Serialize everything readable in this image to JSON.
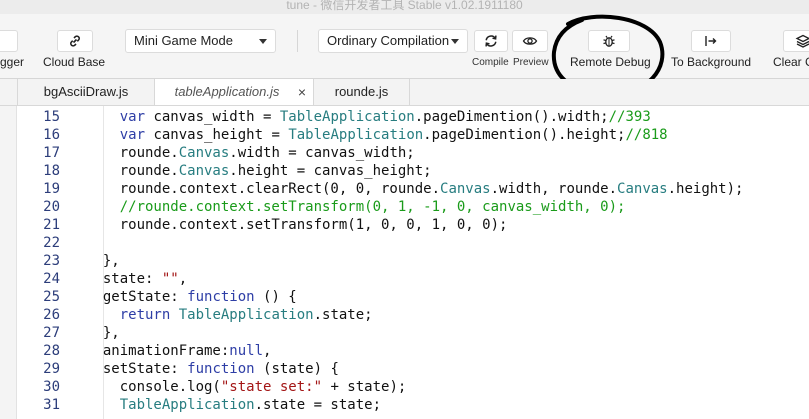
{
  "window": {
    "title": "tune - 微信开发者工具 Stable v1.02.1911180"
  },
  "toolbar": {
    "debugger_label": "gger",
    "cloud_label": "Cloud Base",
    "mode_select": "Mini Game Mode",
    "compile_select": "Ordinary Compilation",
    "compile_label": "Compile",
    "preview_label": "Preview",
    "remote_debug_label": "Remote Debug",
    "background_label": "To Background",
    "clear_label": "Clear C"
  },
  "tabs": [
    {
      "label": "bgAsciiDraw.js"
    },
    {
      "label": "tableApplication.js",
      "close": "×"
    },
    {
      "label": "rounde.js"
    }
  ],
  "editor": {
    "lines": [
      {
        "n": "15",
        "text": "    var canvas_width = TableApplication.pageDimention().width;//393"
      },
      {
        "n": "16",
        "text": "    var canvas_height = TableApplication.pageDimention().height;//818"
      },
      {
        "n": "17",
        "text": "    rounde.Canvas.width = canvas_width;"
      },
      {
        "n": "18",
        "text": "    rounde.Canvas.height = canvas_height;"
      },
      {
        "n": "19",
        "text": "    rounde.context.clearRect(0, 0, rounde.Canvas.width, rounde.Canvas.height);"
      },
      {
        "n": "20",
        "text": "    //rounde.context.setTransform(0, 1, -1, 0, canvas_width, 0);"
      },
      {
        "n": "21",
        "text": "    rounde.context.setTransform(1, 0, 0, 1, 0, 0);"
      },
      {
        "n": "22",
        "text": ""
      },
      {
        "n": "23",
        "text": "  },"
      },
      {
        "n": "24",
        "text": "  state: \"\","
      },
      {
        "n": "25",
        "text": "  getState: function () {"
      },
      {
        "n": "26",
        "text": "    return TableApplication.state;"
      },
      {
        "n": "27",
        "text": "  },"
      },
      {
        "n": "28",
        "text": "  animationFrame:null,"
      },
      {
        "n": "29",
        "text": "  setState: function (state) {"
      },
      {
        "n": "30",
        "text": "    console.log(\"state set:\" + state);"
      },
      {
        "n": "31",
        "text": "    TableApplication.state = state;"
      }
    ]
  },
  "colors": {
    "keyword": "#2e3ea6",
    "class": "#277d80",
    "string": "#a31515",
    "comment": "#1a9b1a"
  }
}
